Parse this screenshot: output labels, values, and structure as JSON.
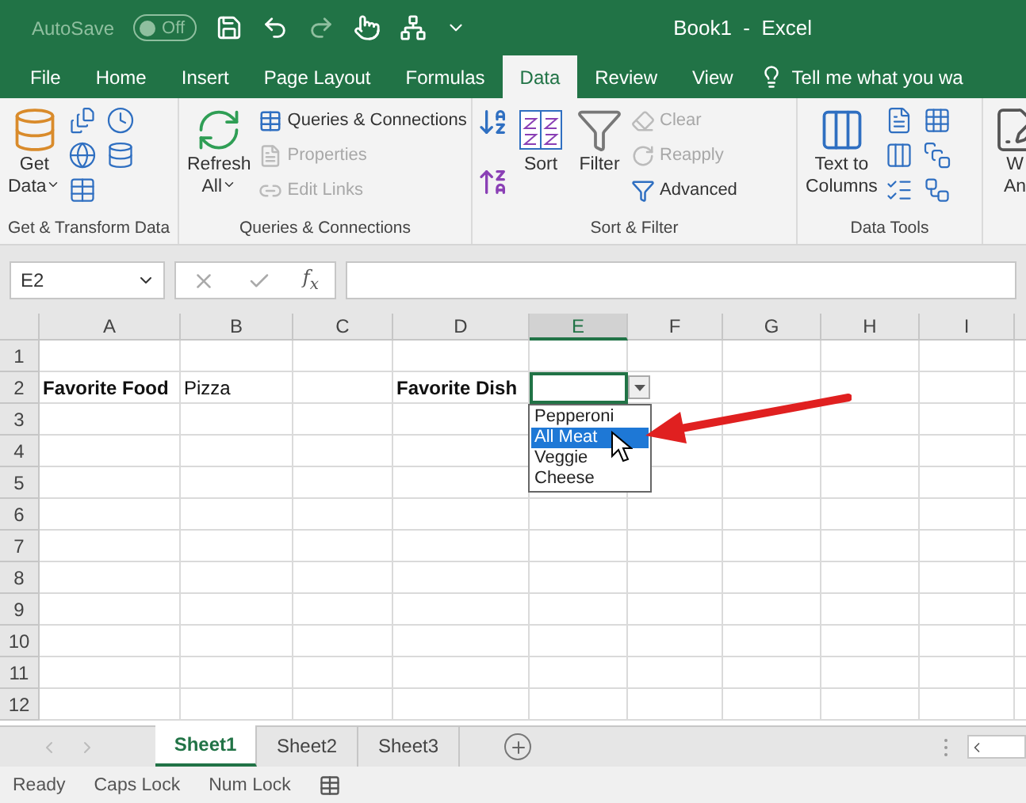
{
  "title_bar": {
    "autosave_label": "AutoSave",
    "autosave_toggle": {
      "label": "Off",
      "on": false
    },
    "title": "Book1  -  Excel"
  },
  "tabs": [
    {
      "label": "File",
      "selected": false
    },
    {
      "label": "Home",
      "selected": false
    },
    {
      "label": "Insert",
      "selected": false
    },
    {
      "label": "Page Layout",
      "selected": false
    },
    {
      "label": "Formulas",
      "selected": false
    },
    {
      "label": "Data",
      "selected": true
    },
    {
      "label": "Review",
      "selected": false
    },
    {
      "label": "View",
      "selected": false
    }
  ],
  "tell_me": "Tell me what you wa",
  "ribbon_groups": [
    {
      "label": "Get & Transform Data",
      "items": [
        {
          "kind": "large",
          "lines": [
            "Get",
            "Data"
          ],
          "caret": true
        },
        {
          "kind": "icons"
        }
      ]
    },
    {
      "label": "Queries & Connections",
      "items": [
        {
          "kind": "large",
          "lines": [
            "Refresh",
            "All"
          ],
          "caret": true
        },
        {
          "kind": "small",
          "label": "Queries & Connections",
          "disabled": false
        },
        {
          "kind": "small",
          "label": "Properties",
          "disabled": true
        },
        {
          "kind": "small",
          "label": "Edit Links",
          "disabled": true
        }
      ]
    },
    {
      "label": "Sort & Filter",
      "items": [
        {
          "kind": "sorticons"
        },
        {
          "kind": "large",
          "lines": [
            "Sort"
          ],
          "caret": false
        },
        {
          "kind": "large",
          "lines": [
            "Filter"
          ],
          "caret": false
        },
        {
          "kind": "small",
          "label": "Clear",
          "disabled": true
        },
        {
          "kind": "small",
          "label": "Reapply",
          "disabled": true
        },
        {
          "kind": "small",
          "label": "Advanced",
          "disabled": false
        }
      ]
    },
    {
      "label": "Data Tools",
      "items": [
        {
          "kind": "large",
          "lines": [
            "Text to",
            "Columns"
          ],
          "caret": false
        },
        {
          "kind": "icons"
        }
      ]
    },
    {
      "items": [
        {
          "kind": "large",
          "lines": [
            "W",
            "An"
          ],
          "caret": false
        }
      ]
    }
  ],
  "name_box": "E2",
  "fx_label": "f$_{x}$",
  "columns": [
    {
      "label": "A",
      "selected": false
    },
    {
      "label": "B",
      "selected": false
    },
    {
      "label": "C",
      "selected": false
    },
    {
      "label": "D",
      "selected": false
    },
    {
      "label": "E",
      "selected": true
    },
    {
      "label": "F",
      "selected": false
    },
    {
      "label": "G",
      "selected": false
    },
    {
      "label": "H",
      "selected": false
    },
    {
      "label": "I",
      "selected": false
    }
  ],
  "rows": [
    {
      "label": "1",
      "cells": []
    },
    {
      "label": "2",
      "cells": [
        {
          "text": "Favorite Food",
          "bold": true
        },
        {
          "text": "Pizza",
          "bold": false
        },
        {},
        {
          "text": "Favorite Dish",
          "bold": true
        },
        {
          "active": true
        }
      ]
    },
    {
      "label": "3",
      "cells": []
    },
    {
      "label": "4",
      "cells": []
    },
    {
      "label": "5",
      "cells": []
    },
    {
      "label": "6",
      "cells": []
    },
    {
      "label": "7",
      "cells": []
    },
    {
      "label": "8",
      "cells": []
    },
    {
      "label": "9",
      "cells": []
    },
    {
      "label": "10",
      "cells": []
    },
    {
      "label": "11",
      "cells": []
    },
    {
      "label": "12",
      "cells": []
    }
  ],
  "dropdown": {
    "options": [
      {
        "label": "Pepperoni",
        "selected": false
      },
      {
        "label": "All Meat",
        "selected": true
      },
      {
        "label": "Veggie",
        "selected": false
      },
      {
        "label": "Cheese",
        "selected": false
      }
    ]
  },
  "sheets": [
    {
      "label": "Sheet1",
      "selected": true
    },
    {
      "label": "Sheet2",
      "selected": false
    },
    {
      "label": "Sheet3",
      "selected": false
    }
  ],
  "status_bar": [
    "Ready",
    "Caps Lock",
    "Num Lock"
  ]
}
